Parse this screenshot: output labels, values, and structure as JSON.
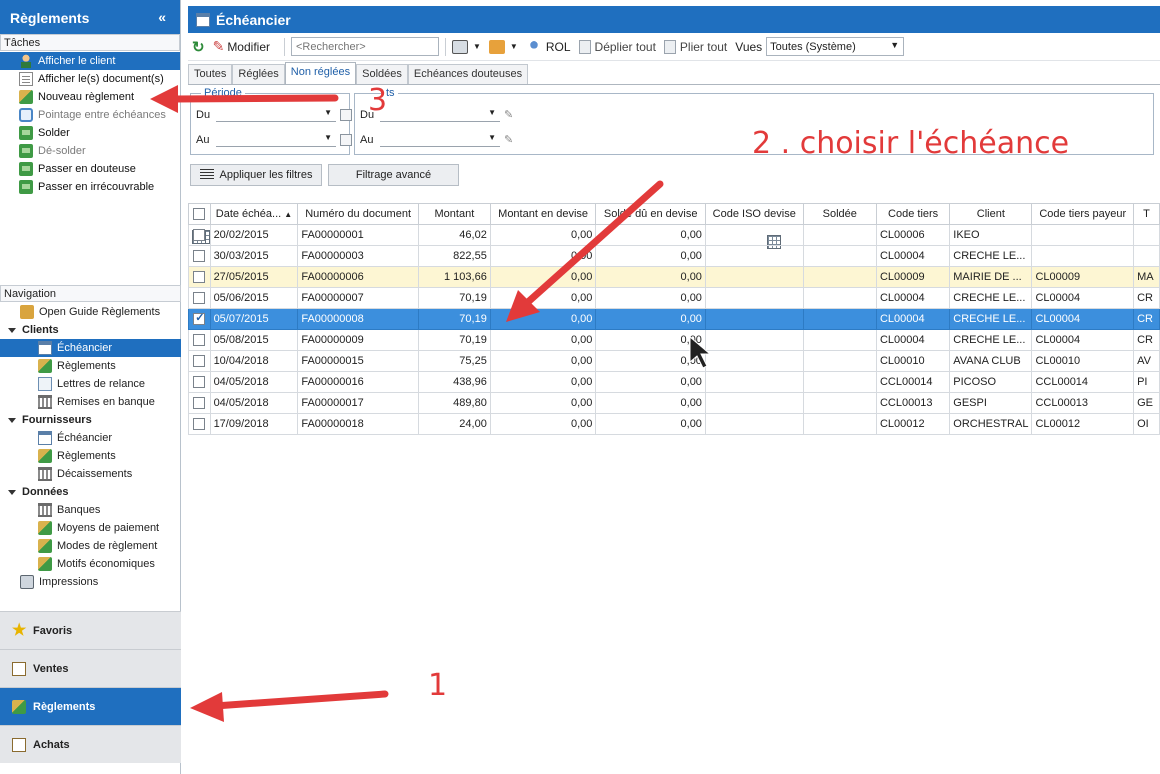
{
  "left": {
    "title": "Règlements",
    "collapse_glyph": "«",
    "tasks_title": "Tâches",
    "tasks": [
      {
        "label": "Afficher le client",
        "icon": "client-icon",
        "selected": true
      },
      {
        "label": "Afficher le(s) document(s)",
        "icon": "document-icon"
      },
      {
        "label": "Nouveau règlement",
        "icon": "payment-icon"
      },
      {
        "label": "Pointage entre échéances",
        "icon": "sync-icon",
        "disabled": true
      },
      {
        "label": "Solder",
        "icon": "settle-icon"
      },
      {
        "label": "Dé-solder",
        "icon": "settle-icon",
        "disabled": true
      },
      {
        "label": "Passer en douteuse",
        "icon": "settle-icon"
      },
      {
        "label": "Passer en irrécouvrable",
        "icon": "settle-icon"
      }
    ],
    "nav_title": "Navigation",
    "nav": {
      "guide": "Open Guide Règlements",
      "clients": "Clients",
      "clients_items": [
        "Échéancier",
        "Règlements",
        "Lettres de relance",
        "Remises en banque"
      ],
      "fournisseurs": "Fournisseurs",
      "fournisseurs_items": [
        "Échéancier",
        "Règlements",
        "Décaissements"
      ],
      "donnees": "Données",
      "donnees_items": [
        "Banques",
        "Moyens de paiement",
        "Modes de règlement",
        "Motifs économiques"
      ],
      "impressions": "Impressions"
    },
    "modules": [
      "Favoris",
      "Ventes",
      "Règlements",
      "Achats"
    ]
  },
  "main": {
    "title": "Échéancier",
    "toolbar": {
      "modify": "Modifier",
      "search_placeholder": "<Rechercher>",
      "rol": "ROL",
      "unfold": "Déplier tout",
      "fold": "Plier tout",
      "views_label": "Vues",
      "views_value": "Toutes (Système)"
    },
    "tabs": [
      "Toutes",
      "Réglées",
      "Non réglées",
      "Soldées",
      "Echéances douteuses"
    ],
    "filters": {
      "group1_legend": "Période",
      "group2_legend": "ts",
      "du": "Du",
      "au": "Au"
    },
    "apply_filters": "Appliquer les filtres",
    "advanced_filter": "Filtrage avancé",
    "columns": [
      "Date échéa...",
      "Numéro du document",
      "Montant",
      "Montant en devise",
      "Solde dû en devise",
      "Code ISO devise",
      "Soldée",
      "Code tiers",
      "Client",
      "Code tiers payeur",
      "T"
    ],
    "rows": [
      {
        "date": "20/02/2015",
        "doc": "FA00000001",
        "montant": "46,02",
        "devise": "0,00",
        "solde": "0,00",
        "iso": "",
        "soldee": "",
        "tiers": "CL00006",
        "client": "IKEO",
        "payeur": "",
        "t": ""
      },
      {
        "date": "30/03/2015",
        "doc": "FA00000003",
        "montant": "822,55",
        "devise": "0,00",
        "solde": "0,00",
        "iso": "",
        "soldee": "",
        "tiers": "CL00004",
        "client": "CRECHE LE...",
        "payeur": "",
        "t": ""
      },
      {
        "date": "27/05/2015",
        "doc": "FA00000006",
        "montant": "1 103,66",
        "devise": "0,00",
        "solde": "0,00",
        "iso": "",
        "soldee": "",
        "tiers": "CL00009",
        "client": "MAIRIE DE ...",
        "payeur": "CL00009",
        "t": "MA"
      },
      {
        "date": "05/06/2015",
        "doc": "FA00000007",
        "montant": "70,19",
        "devise": "0,00",
        "solde": "0,00",
        "iso": "",
        "soldee": "",
        "tiers": "CL00004",
        "client": "CRECHE LE...",
        "payeur": "CL00004",
        "t": "CR"
      },
      {
        "date": "05/07/2015",
        "doc": "FA00000008",
        "montant": "70,19",
        "devise": "0,00",
        "solde": "0,00",
        "iso": "",
        "soldee": "",
        "tiers": "CL00004",
        "client": "CRECHE LE...",
        "payeur": "CL00004",
        "t": "CR"
      },
      {
        "date": "05/08/2015",
        "doc": "FA00000009",
        "montant": "70,19",
        "devise": "0,00",
        "solde": "0,00",
        "iso": "",
        "soldee": "",
        "tiers": "CL00004",
        "client": "CRECHE LE...",
        "payeur": "CL00004",
        "t": "CR"
      },
      {
        "date": "10/04/2018",
        "doc": "FA00000015",
        "montant": "75,25",
        "devise": "0,00",
        "solde": "0,00",
        "iso": "",
        "soldee": "",
        "tiers": "CL00010",
        "client": "AVANA CLUB",
        "payeur": "CL00010",
        "t": "AV"
      },
      {
        "date": "04/05/2018",
        "doc": "FA00000016",
        "montant": "438,96",
        "devise": "0,00",
        "solde": "0,00",
        "iso": "",
        "soldee": "",
        "tiers": "CCL00014",
        "client": "PICOSO",
        "payeur": "CCL00014",
        "t": "PI"
      },
      {
        "date": "04/05/2018",
        "doc": "FA00000017",
        "montant": "489,80",
        "devise": "0,00",
        "solde": "0,00",
        "iso": "",
        "soldee": "",
        "tiers": "CCL00013",
        "client": "GESPI",
        "payeur": "CCL00013",
        "t": "GE"
      },
      {
        "date": "17/09/2018",
        "doc": "FA00000018",
        "montant": "24,00",
        "devise": "0,00",
        "solde": "0,00",
        "iso": "",
        "soldee": "",
        "tiers": "CL00012",
        "client": "ORCHESTRAL",
        "payeur": "CL00012",
        "t": "OI"
      }
    ],
    "highlighted_row": 2,
    "selected_row": 4
  },
  "annotations": {
    "step1": "1",
    "step2": "2 . choisir l'échéance",
    "step3": "3",
    "color": "#e23a3a"
  },
  "colors": {
    "accent": "#1f6fbf",
    "selected_row": "#3c8fdd",
    "highlight_row": "#fdf6d3"
  }
}
